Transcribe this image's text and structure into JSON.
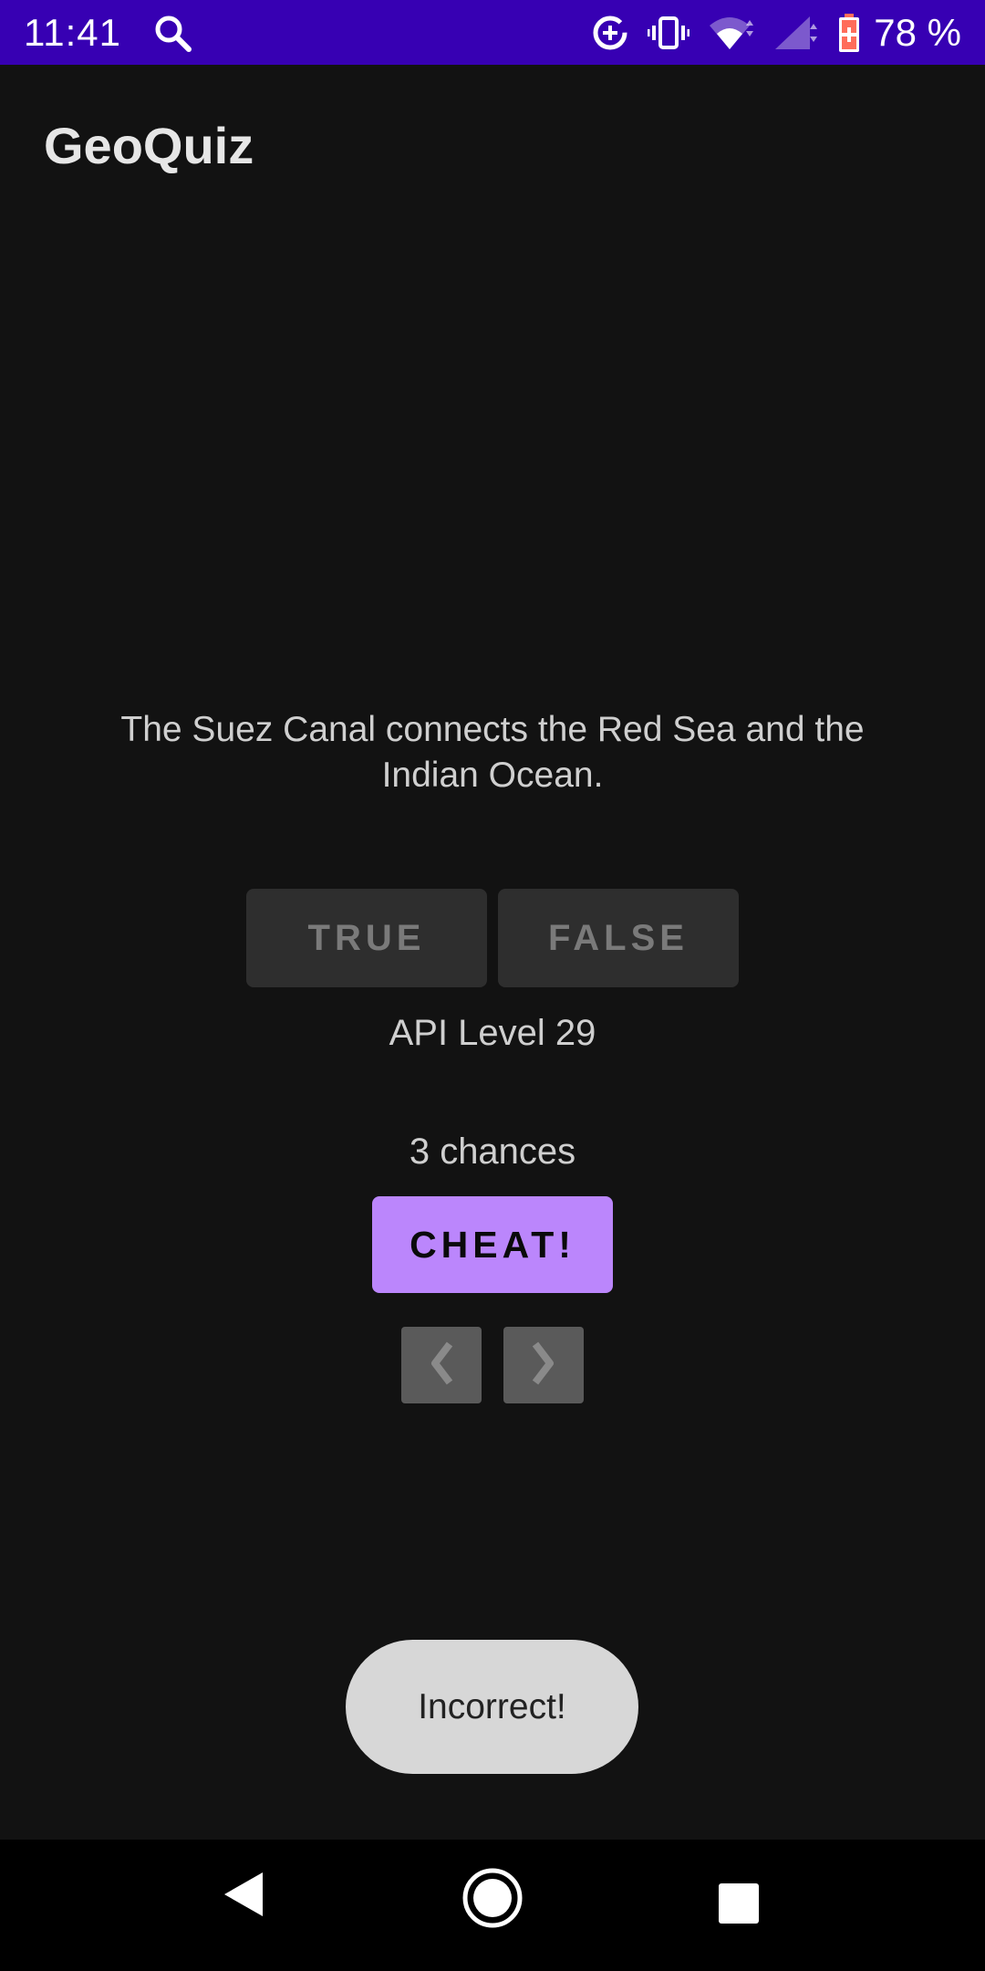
{
  "status_bar": {
    "time": "11:41",
    "battery": "78 %",
    "icons": [
      "search-icon",
      "data-saver-icon",
      "vibrate-icon",
      "wifi-icon",
      "signal-icon",
      "battery-icon"
    ]
  },
  "app_bar": {
    "title": "GeoQuiz"
  },
  "quiz": {
    "question": "The Suez Canal connects the Red Sea and the Indian Ocean.",
    "true_label": "TRUE",
    "false_label": "FALSE",
    "api_level": "API Level 29",
    "chances": "3 chances",
    "cheat_label": "CHEAT!",
    "prev_icon": "❰",
    "next_icon": "❱"
  },
  "toast": {
    "message": "Incorrect!"
  },
  "nav_bar": {
    "icons": [
      "back-icon",
      "home-icon",
      "recents-icon"
    ]
  },
  "colors": {
    "status_bar": "#3700b3",
    "background": "#121212",
    "cheat_button": "#bb86fc",
    "answer_button": "#2e2e2e",
    "toast": "#d7d7d7"
  }
}
